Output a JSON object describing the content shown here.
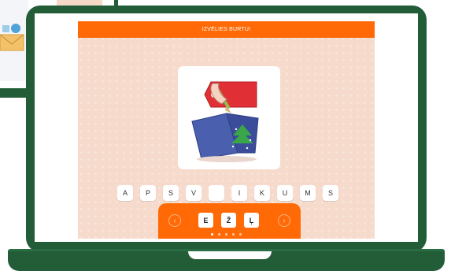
{
  "app": {
    "title": "IZVĒLIES BURTU!"
  },
  "word_slots": [
    "A",
    "P",
    "S",
    "V",
    "",
    "I",
    "K",
    "U",
    "M",
    "S"
  ],
  "choices": [
    "E",
    "Ž",
    "Ļ"
  ],
  "nav": {
    "prev_glyph": "‹",
    "next_glyph": "›"
  },
  "pagination": {
    "count": 5,
    "active_index": 0
  },
  "colors": {
    "accent": "#ff6a06",
    "frame": "#235d38",
    "app_background": "#f6dbcd"
  },
  "icons": [
    "envelope-icon",
    "gift-card-icon",
    "chevron-left-icon",
    "chevron-right-icon"
  ]
}
